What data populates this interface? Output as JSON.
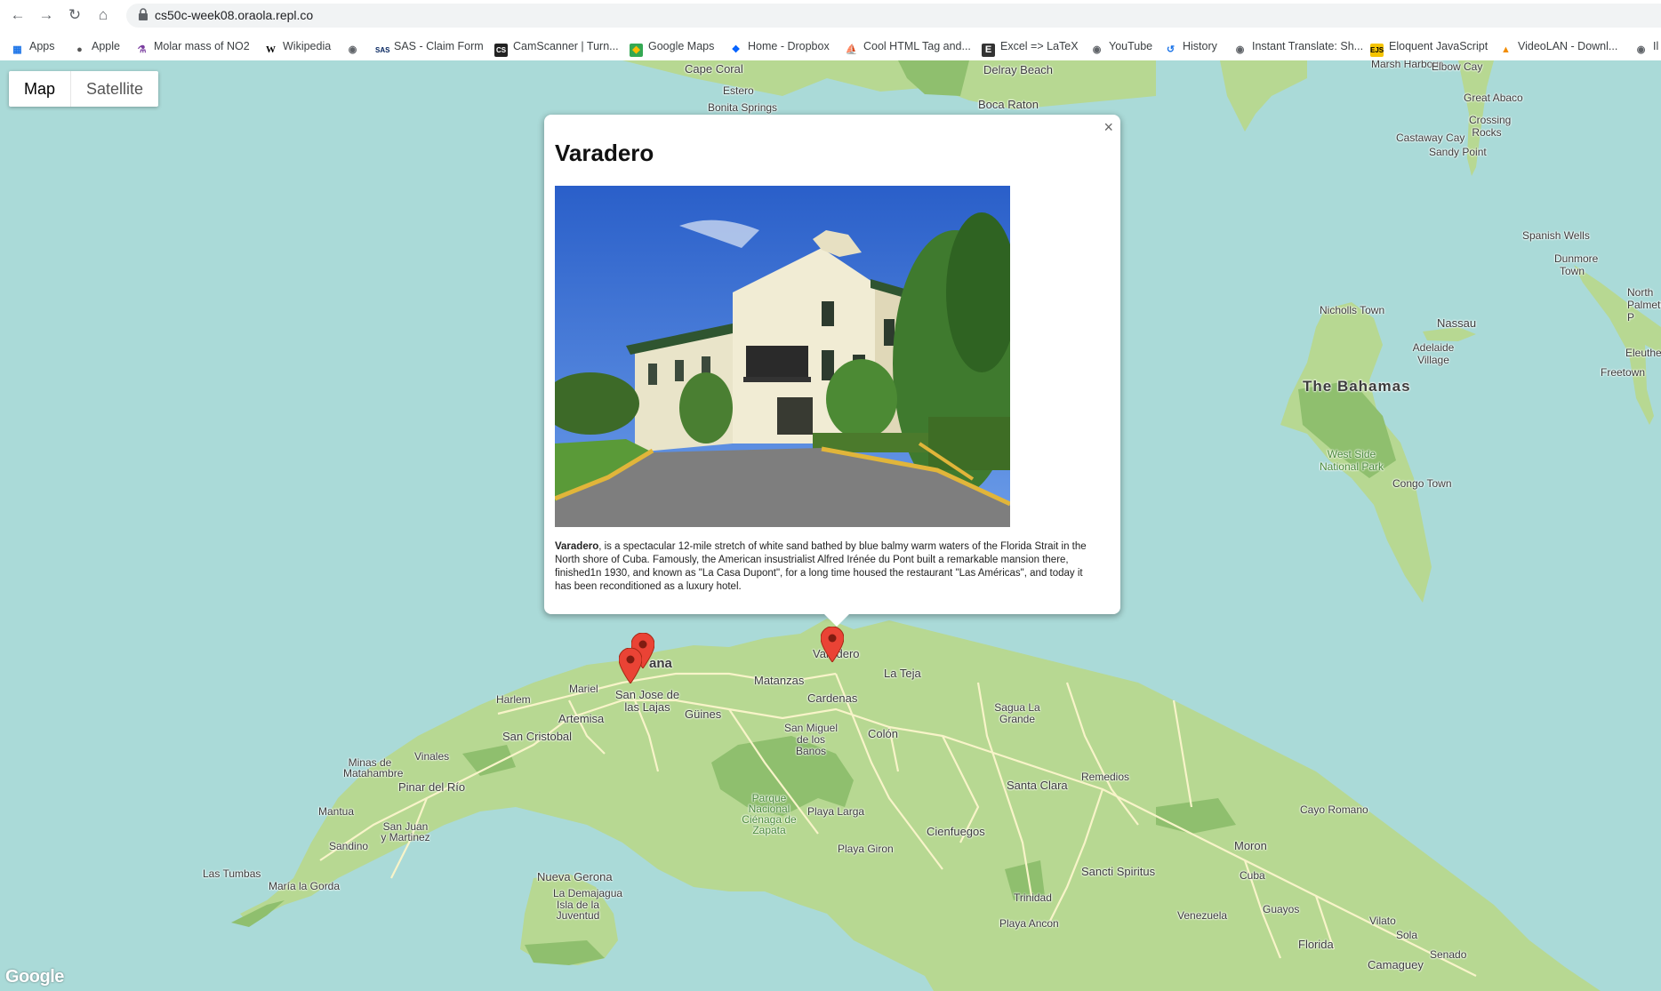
{
  "browser": {
    "url": "cs50c-week08.oraola.repl.co",
    "bookmarks": [
      {
        "label": "Apps",
        "icon": "apps-grid-icon"
      },
      {
        "label": "Apple",
        "icon": "apple-icon"
      },
      {
        "label": "Molar mass of NO2",
        "icon": "flask-icon"
      },
      {
        "label": "Wikipedia",
        "icon": "wikipedia-icon"
      },
      {
        "label": "",
        "icon": "globe-icon"
      },
      {
        "label": "SAS - Claim Form",
        "icon": "sas-icon"
      },
      {
        "label": "CamScanner | Turn...",
        "icon": "camscanner-icon"
      },
      {
        "label": "Google Maps",
        "icon": "google-maps-icon"
      },
      {
        "label": "Home - Dropbox",
        "icon": "dropbox-icon"
      },
      {
        "label": "Cool HTML Tag and...",
        "icon": "sail-icon"
      },
      {
        "label": "Excel => LaTeX",
        "icon": "latex-icon"
      },
      {
        "label": "YouTube",
        "icon": "globe-icon"
      },
      {
        "label": "History",
        "icon": "history-icon"
      },
      {
        "label": "Instant Translate: Sh...",
        "icon": "globe-icon"
      },
      {
        "label": "Eloquent JavaScript",
        "icon": "ejs-icon"
      },
      {
        "label": "VideoLAN - Downl...",
        "icon": "vlc-icon"
      },
      {
        "label": "Il",
        "icon": "globe-icon"
      }
    ]
  },
  "map": {
    "type_buttons": [
      "Map",
      "Satellite"
    ],
    "active_type": "Map",
    "logo": "Google",
    "labels": {
      "cape_coral": "Cape Coral",
      "estero": "Estero",
      "bonita_springs": "Bonita Springs",
      "delray_beach": "Delray Beach",
      "boca_raton": "Boca Raton",
      "marsh_harbour": "Marsh Harbour",
      "elbow_cay": "Elbow Cay",
      "great_abaco": "Great Abaco",
      "crossing_rocks": "Crossing Rocks",
      "castaway_cay": "Castaway Cay",
      "sandy_point": "Sandy Point",
      "spanish_wells": "Spanish Wells",
      "dunmore_town": "Dunmore Town",
      "north_palmetto": "North Palmetto P",
      "nicholls_town": "Nicholls Town",
      "nassau": "Nassau",
      "adelaide_village": "Adelaide Village",
      "eleuthera": "Eleuther",
      "freetown": "Freetown",
      "the_bahamas": "The Bahamas",
      "west_side": "West Side National Park",
      "congo_town": "Congo Town",
      "havana": "ana",
      "varadero": "Varadero",
      "la_teja": "La Teja",
      "matanzas": "Matanzas",
      "mariel": "Mariel",
      "harlem": "Harlem",
      "san_jose": "San Jose de las Lajas",
      "artemisa": "Artemisa",
      "guines": "Güines",
      "cardenas": "Cardenas",
      "san_cristobal": "San Cristobal",
      "san_miguel": "San Miguel de los Banos",
      "colon": "Colón",
      "sagua": "Sagua La Grande",
      "minas": "Minas de Matahambre",
      "vinales": "Vinales",
      "pinar": "Pinar del Río",
      "remedios": "Remedios",
      "santa_clara": "Santa Clara",
      "parque": "Parque Nacional Ciénaga de Zapata",
      "playa_larga": "Playa Larga",
      "mantua": "Mantua",
      "san_juan": "San Juan y Martinez",
      "playa_giron": "Playa Giron",
      "cienfuegos": "Cienfuegos",
      "cayo_romano": "Cayo Romano",
      "sandino": "Sandino",
      "moron": "Moron",
      "las_tumbas": "Las Tumbas",
      "maria_gorda": "María la Gorda",
      "nueva_gerona": "Nueva Gerona",
      "la_demajagua": "La Demajagua",
      "isla": "Isla de la Juventud",
      "sancti": "Sancti Spiritus",
      "cuba": "Cuba",
      "trinidad": "Trinidad",
      "venezuela": "Venezuela",
      "guayos": "Guayos",
      "playa_ancon": "Playa Ancon",
      "vilato": "Vilato",
      "sola": "Sola",
      "senado": "Senado",
      "florida": "Florida",
      "camaguey": "Camaguey"
    }
  },
  "infowindow": {
    "title": "Varadero",
    "close": "×",
    "desc_bold": "Varadero",
    "desc_rest": ", is a spectacular 12-mile stretch of white sand bathed by blue balmy warm waters of the Florida Strait in the North shore of Cuba. Famously, the American insustrialist Alfred Irénée du Pont built a remarkable mansion there, finished1n 1930, and known as \"La Casa Dupont\", for a long time housed the restaurant \"Las Américas\", and today it has been reconditioned as a luxury hotel.",
    "photo_subject": "La Casa Dupont mansion"
  },
  "colors": {
    "water": "#aadad8",
    "land": "#b7d892",
    "land_dark": "#8fbf6e",
    "road": "#f8f4c9",
    "marker": "#ea4335"
  }
}
